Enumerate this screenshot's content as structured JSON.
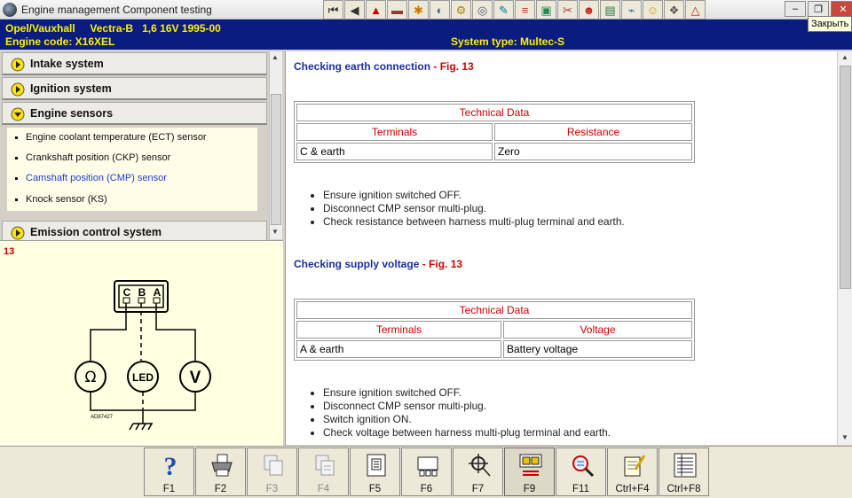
{
  "window": {
    "title": "Engine management Component testing",
    "tooltip": "Закрыть"
  },
  "toolbar": {
    "icons": [
      "first-icon",
      "prev-icon",
      "warning-icon",
      "vehicle-icon",
      "engine-icon",
      "belt-icon",
      "timing-icon",
      "tool-icon",
      "exhaust-icon",
      "tyre-icon",
      "car-icon",
      "car2-icon",
      "oil-icon",
      "brake-icon",
      "gearbox-icon",
      "warning2-icon",
      "wiring-icon",
      "document-icon"
    ]
  },
  "vehicle": {
    "make": "Opel/Vauxhall",
    "model": "Vectra-B",
    "spec": "1,6 16V 1995-00",
    "engine_code": "Engine code: X16XEL",
    "system_type": "System type: Multec-S"
  },
  "sidebar": {
    "sections": [
      {
        "label": "Intake system"
      },
      {
        "label": "Ignition system"
      },
      {
        "label": "Engine sensors"
      },
      {
        "label": "Emission control system"
      }
    ],
    "items": [
      {
        "label": "Engine coolant temperature (ECT) sensor"
      },
      {
        "label": "Crankshaft position (CKP) sensor"
      },
      {
        "label": "Camshaft position (CMP) sensor"
      },
      {
        "label": "Knock sensor (KS)"
      }
    ]
  },
  "figure": {
    "number": "13",
    "pins": [
      "C",
      "B",
      "A"
    ],
    "meters": [
      "Ω",
      "LED",
      "V"
    ],
    "code": "AD87427"
  },
  "content": {
    "sections": [
      {
        "title": "Checking earth connection",
        "fig": "- Fig. 13",
        "table": {
          "caption": "Technical Data",
          "headers": [
            "Terminals",
            "Resistance"
          ],
          "row": [
            "C & earth",
            "Zero"
          ]
        },
        "steps": [
          "Ensure ignition switched OFF.",
          "Disconnect CMP sensor multi-plug.",
          "Check resistance between harness multi-plug terminal and earth."
        ]
      },
      {
        "title": "Checking supply voltage",
        "fig": "- Fig. 13",
        "table": {
          "caption": "Technical Data",
          "headers": [
            "Terminals",
            "Voltage"
          ],
          "row": [
            "A & earth",
            "Battery voltage"
          ]
        },
        "steps": [
          "Ensure ignition switched OFF.",
          "Disconnect CMP sensor multi-plug.",
          "Switch ignition ON.",
          "Check voltage between harness multi-plug terminal and earth."
        ]
      }
    ]
  },
  "function_keys": [
    {
      "label": "F1",
      "icon": "help-icon",
      "enabled": true
    },
    {
      "label": "F2",
      "icon": "print-icon",
      "enabled": true
    },
    {
      "label": "F3",
      "icon": "copy-icon",
      "enabled": false
    },
    {
      "label": "F4",
      "icon": "paste-icon",
      "enabled": false
    },
    {
      "label": "F5",
      "icon": "connector-icon",
      "enabled": true
    },
    {
      "label": "F6",
      "icon": "component-icon",
      "enabled": true
    },
    {
      "label": "F7",
      "icon": "location-icon",
      "enabled": true
    },
    {
      "label": "F9",
      "icon": "pinout-icon",
      "enabled": true
    },
    {
      "label": "F11",
      "icon": "search-icon",
      "enabled": true
    },
    {
      "label": "Ctrl+F4",
      "icon": "notes-icon",
      "enabled": true
    },
    {
      "label": "Ctrl+F8",
      "icon": "list-icon",
      "enabled": true
    }
  ]
}
